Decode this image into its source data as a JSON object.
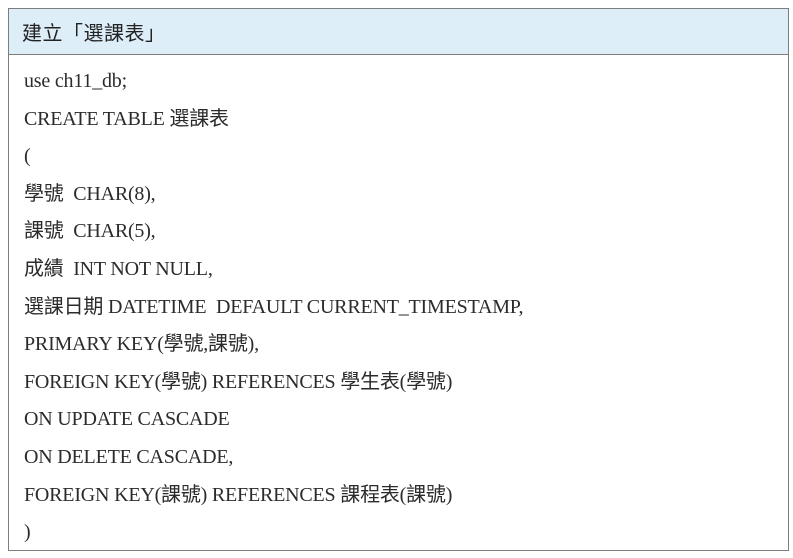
{
  "header": {
    "title": "建立「選課表」"
  },
  "code": {
    "lines": [
      "use ch11_db;",
      "CREATE TABLE 選課表",
      "(",
      "學號  CHAR(8),",
      "課號  CHAR(5),",
      "成績  INT NOT NULL,",
      "選課日期 DATETIME  DEFAULT CURRENT_TIMESTAMP,",
      "PRIMARY KEY(學號,課號),",
      "FOREIGN KEY(學號) REFERENCES 學生表(學號)",
      "ON UPDATE CASCADE",
      "ON DELETE CASCADE,",
      "FOREIGN KEY(課號) REFERENCES 課程表(課號)",
      ")"
    ]
  },
  "colors": {
    "header_background": "#ddeef9",
    "border": "#7d7d7d",
    "text": "#2b2b2b"
  }
}
